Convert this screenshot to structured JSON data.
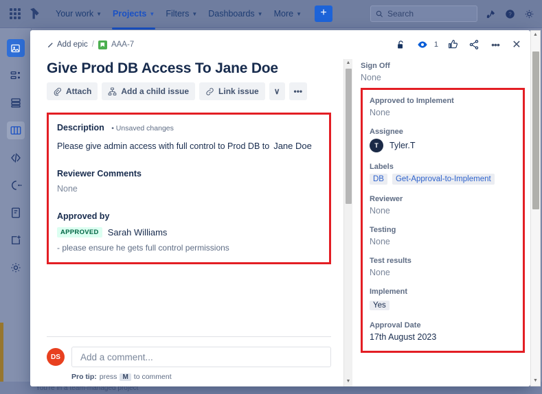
{
  "top_nav": {
    "apps_icon": "grid-apps-icon",
    "logo": "jira-logo",
    "items": [
      {
        "label": "Your work",
        "has_caret": true,
        "active": false
      },
      {
        "label": "Projects",
        "has_caret": true,
        "active": true
      },
      {
        "label": "Filters",
        "has_caret": true,
        "active": false
      },
      {
        "label": "Dashboards",
        "has_caret": true,
        "active": false
      },
      {
        "label": "More",
        "has_caret": true,
        "active": false
      }
    ],
    "create_label": "+",
    "search_placeholder": "Search",
    "right_icons": [
      "notifications-icon",
      "help-icon",
      "settings-icon"
    ]
  },
  "left_rail": {
    "icons": [
      "project-avatar-icon",
      "backlog-icon",
      "roadmap-icon",
      "board-icon",
      "code-icon",
      "releases-icon",
      "pages-icon",
      "add-item-icon",
      "project-settings-icon"
    ]
  },
  "status_bar": {
    "text": "You're in a team-managed project"
  },
  "modal": {
    "breadcrumb": {
      "epic_label": "Add epic",
      "separator": "/",
      "issue_key": "AAA-7",
      "issue_type_icon": "story-icon"
    },
    "actions": [
      {
        "name": "unlock-icon",
        "label": ""
      },
      {
        "name": "watch-icon",
        "label": "1"
      },
      {
        "name": "like-icon",
        "label": ""
      },
      {
        "name": "share-icon",
        "label": ""
      },
      {
        "name": "more-actions-icon",
        "label": "•••"
      },
      {
        "name": "close-icon",
        "label": "✕"
      }
    ],
    "title": "Give Prod DB Access To Jane Doe",
    "toolbar": [
      {
        "label": "Attach",
        "icon": "paperclip-icon"
      },
      {
        "label": "Add a child issue",
        "icon": "child-issue-icon"
      },
      {
        "label": "Link issue",
        "icon": "link-icon"
      },
      {
        "label": "∨",
        "icon": "chevron-down-icon"
      },
      {
        "label": "•••",
        "icon": "more-icon"
      }
    ],
    "description": {
      "label": "Description",
      "unsaved": "• Unsaved changes",
      "text_prefix": "Please give admin access with full control to Prod DB to",
      "text_name": "Jane Doe"
    },
    "reviewer_comments": {
      "label": "Reviewer Comments",
      "value": "None"
    },
    "approved_by": {
      "label": "Approved by",
      "badge": "APPROVED",
      "name": "Sarah Williams",
      "note": "- please ensure he gets full control permissions"
    },
    "comment": {
      "avatar_initials": "DS",
      "placeholder": "Add a comment...",
      "protip_prefix": "Pro tip:",
      "protip_mid": "press",
      "protip_key": "M",
      "protip_suffix": "to comment"
    }
  },
  "details_panel": {
    "sign_off": {
      "label": "Sign Off",
      "value": "None"
    },
    "fields": [
      {
        "label": "Approved to Implement",
        "value": "None",
        "kind": "text"
      },
      {
        "label": "Assignee",
        "value": "Tyler.T",
        "kind": "user",
        "avatar_initial": "T"
      },
      {
        "label": "Labels",
        "kind": "labels",
        "values": [
          "DB",
          "Get-Approval-to-Implement"
        ]
      },
      {
        "label": "Reviewer",
        "value": "None",
        "kind": "text"
      },
      {
        "label": "Testing",
        "value": "None",
        "kind": "text"
      },
      {
        "label": "Test results",
        "value": "None",
        "kind": "text"
      },
      {
        "label": "Implement",
        "value": "Yes",
        "kind": "chip"
      },
      {
        "label": "Approval Date",
        "value": "17th August 2023",
        "kind": "text-dark"
      }
    ]
  },
  "colors": {
    "highlight_red": "#e31e24",
    "jira_blue": "#1d63d8",
    "approved_green_bg": "#dcfff1",
    "approved_green_text": "#006644",
    "avatar_red": "#e8401f",
    "avatar_navy": "#1b2a47"
  }
}
